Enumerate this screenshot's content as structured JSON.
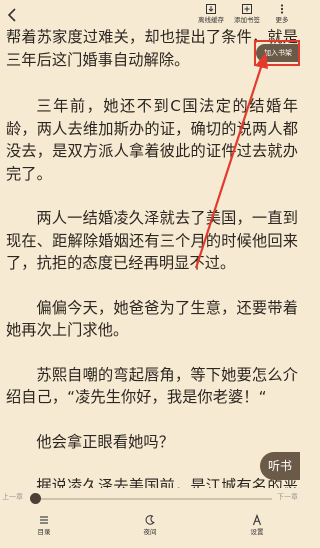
{
  "toolbar": {
    "cache_label": "离线缓存",
    "bookmark_label": "添加书签",
    "more_label": "更多"
  },
  "content": {
    "paragraphs": [
      "帮着苏家度过难关，却也提出了条件，就是三年后这门婚事自动解除。",
      "三年前，她还不到C国法定的结婚年龄，两人去维加斯办的证，确切的说两人都没去，是双方派人拿着彼此的证件过去就办完了。",
      "两人一结婚凌久泽就去了美国，一直到现在、距解除婚姻还有三个月的时候他回来了，抗拒的态度已经再明显不过。",
      "偏偏今天，她爸爸为了生意，还要带着她再次上门求他。",
      "苏熙自嘲的弯起唇角，等下她要怎么介绍自己，“凌先生你好，我是你老婆！“",
      "他会拿正眼看她吗？",
      "据说凌久泽去美国前，是江城有名的恶霸，在"
    ]
  },
  "add_to_shelf_label": "加入书架",
  "listen_label": "听书",
  "progress": {
    "prev_label": "上一章",
    "next_label": "下一章",
    "position": 0.0
  },
  "bottom_nav": {
    "catalog_label": "目录",
    "night_label": "夜间",
    "settings_label": "设置"
  },
  "colors": {
    "background": "#f6ead3",
    "text": "#2c2620",
    "annotation_red": "#e23b2e",
    "pill_bg": "#6b5a48"
  }
}
